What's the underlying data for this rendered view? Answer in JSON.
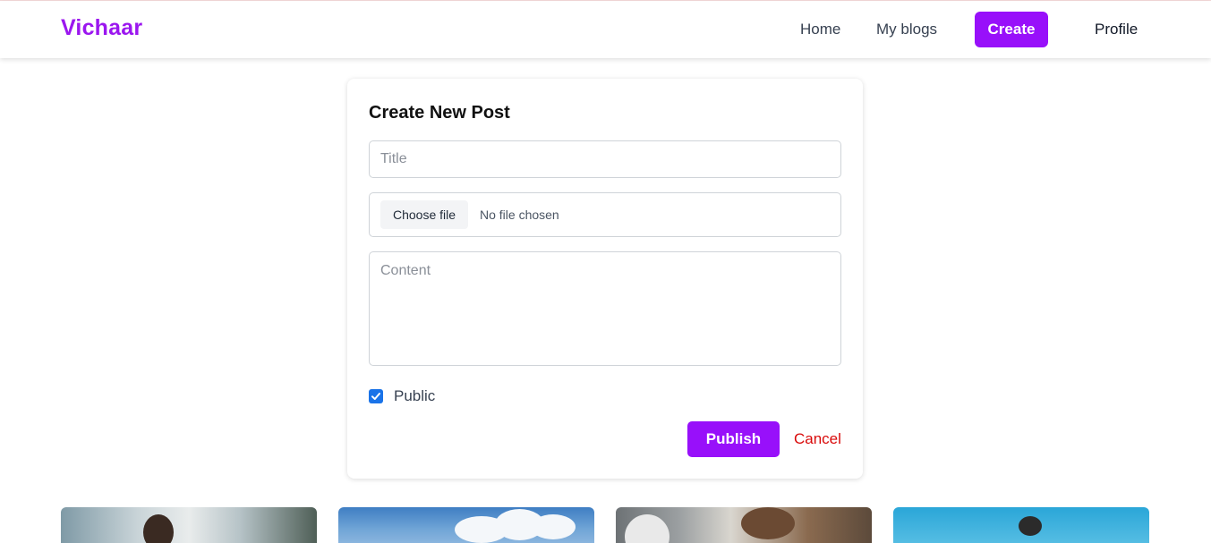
{
  "brand": {
    "name": "Vichaar",
    "color": "#9b16ef"
  },
  "nav": {
    "home": "Home",
    "my_blogs": "My blogs",
    "create": "Create",
    "profile": "Profile"
  },
  "form": {
    "heading": "Create New Post",
    "title_placeholder": "Title",
    "title_value": "",
    "file_button": "Choose file",
    "file_status": "No file chosen",
    "content_placeholder": "Content",
    "content_value": "",
    "public_label": "Public",
    "public_checked": true,
    "publish_label": "Publish",
    "cancel_label": "Cancel"
  },
  "colors": {
    "accent": "#9810fa",
    "cancel": "#d90a0a",
    "checkbox": "#1a73e8"
  },
  "thumbnails": [
    {
      "alt": "post-thumbnail-1"
    },
    {
      "alt": "post-thumbnail-2"
    },
    {
      "alt": "post-thumbnail-3"
    },
    {
      "alt": "post-thumbnail-4"
    }
  ]
}
